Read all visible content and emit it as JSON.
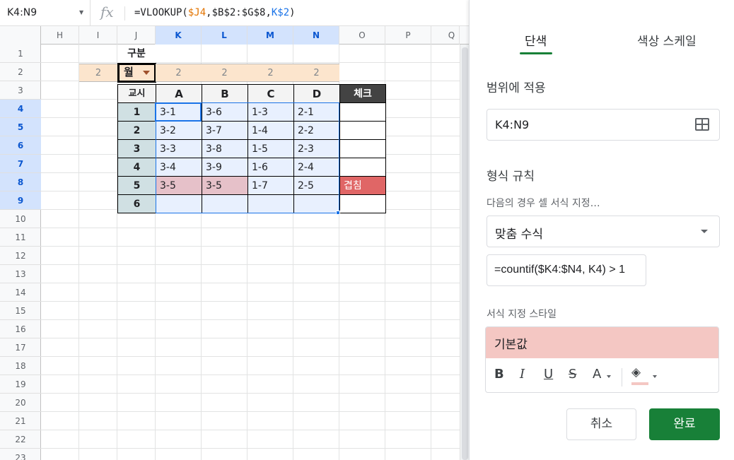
{
  "formula_bar": {
    "name_box": "K4:N9",
    "fx": "fx",
    "formula_parts": [
      "=VLOOKUP(",
      "$J4",
      ",$B$2:$G$8,",
      "K$2",
      ")"
    ]
  },
  "columns": [
    "H",
    "I",
    "J",
    "K",
    "L",
    "M",
    "N",
    "O",
    "P",
    "Q"
  ],
  "rows": [
    "1",
    "2",
    "3",
    "4",
    "5",
    "6",
    "7",
    "8",
    "9",
    "10",
    "11",
    "12",
    "13",
    "14",
    "15",
    "16",
    "17",
    "18",
    "19",
    "20",
    "21",
    "22",
    "23"
  ],
  "sheet": {
    "j1_label": "구분",
    "j2_dropdown": "월",
    "row2_values": {
      "I": "2",
      "K": "2",
      "L": "2",
      "M": "2",
      "N": "2"
    },
    "header_row": {
      "J": "교시",
      "K": "A",
      "L": "B",
      "M": "C",
      "N": "D",
      "O": "체크"
    },
    "periods": [
      "1",
      "2",
      "3",
      "4",
      "5",
      "6"
    ],
    "table": [
      [
        "3-1",
        "3-6",
        "1-3",
        "2-1",
        ""
      ],
      [
        "3-2",
        "3-7",
        "1-4",
        "2-2",
        ""
      ],
      [
        "3-3",
        "3-8",
        "1-5",
        "2-3",
        ""
      ],
      [
        "3-4",
        "3-9",
        "1-6",
        "2-4",
        ""
      ],
      [
        "3-5",
        "3-5",
        "1-7",
        "2-5",
        "겹침"
      ],
      [
        "",
        "",
        "",
        "",
        ""
      ]
    ]
  },
  "panel": {
    "tab_single": "단색",
    "tab_color_scale": "색상 스케일",
    "apply_to_range_label": "범위에 적용",
    "range_value": "K4:N9",
    "format_rules_label": "형식 규칙",
    "condition_label": "다음의 경우 셀 서식 지정…",
    "condition_value": "맞춤 수식",
    "formula_value": "=countif($K4:$N4, K4) > 1",
    "style_label": "서식 지정 스타일",
    "style_preview": "기본값",
    "fmt_bold": "B",
    "fmt_italic": "I",
    "fmt_underline": "U",
    "fmt_strike": "S",
    "fmt_text_color": "A",
    "fmt_fill": "◈",
    "cancel_label": "취소",
    "done_label": "완료",
    "colors": {
      "accent": "#188038",
      "preview_fill": "#f4c7c3",
      "highlight": "#e06666",
      "duplicate": "#e6c1c9"
    }
  }
}
